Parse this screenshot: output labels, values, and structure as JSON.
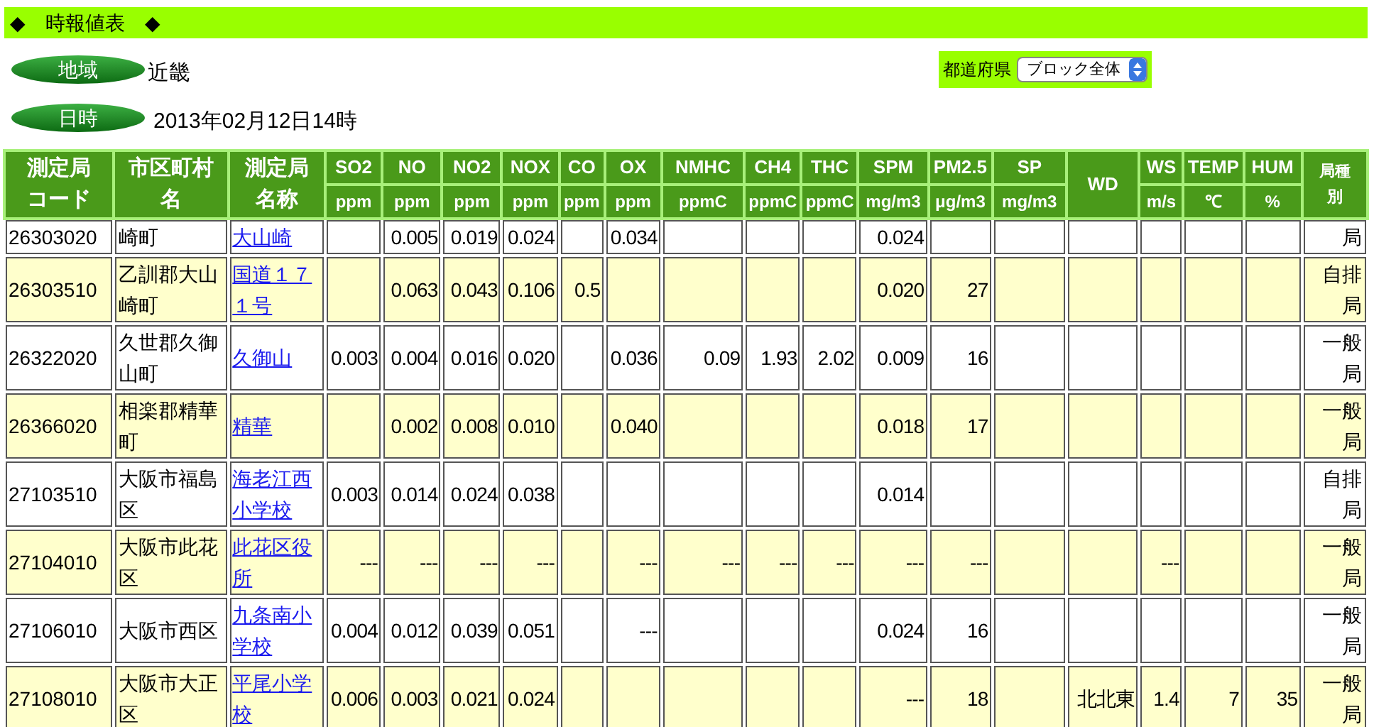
{
  "title_bar": {
    "left_mark": "◆",
    "title": "時報値表",
    "right_mark": "◆"
  },
  "region": {
    "label": "地域",
    "value": "近畿"
  },
  "prefecture": {
    "label": "都道府県",
    "value": "ブロック全体"
  },
  "datetime": {
    "label": "日時",
    "value": "2013年02月12日14時"
  },
  "table": {
    "columns": [
      {
        "label": "測定局コード"
      },
      {
        "label": "市区町村名"
      },
      {
        "label": "測定局名称"
      },
      {
        "label": "SO2",
        "unit": "ppm"
      },
      {
        "label": "NO",
        "unit": "ppm"
      },
      {
        "label": "NO2",
        "unit": "ppm"
      },
      {
        "label": "NOX",
        "unit": "ppm"
      },
      {
        "label": "CO",
        "unit": "ppm"
      },
      {
        "label": "OX",
        "unit": "ppm"
      },
      {
        "label": "NMHC",
        "unit": "ppmC"
      },
      {
        "label": "CH4",
        "unit": "ppmC"
      },
      {
        "label": "THC",
        "unit": "ppmC"
      },
      {
        "label": "SPM",
        "unit": "mg/m3"
      },
      {
        "label": "PM2.5",
        "unit": "μg/m3"
      },
      {
        "label": "SP",
        "unit": "mg/m3"
      },
      {
        "label": "WD"
      },
      {
        "label": "WS",
        "unit": "m/s"
      },
      {
        "label": "TEMP",
        "unit": "℃"
      },
      {
        "label": "HUM",
        "unit": "%"
      },
      {
        "label": "局種別"
      }
    ],
    "rows": [
      {
        "code": "26303020",
        "city": "崎町",
        "station": "大山崎",
        "values": {
          "no": "0.005",
          "no2": "0.019",
          "nox": "0.024",
          "ox": "0.034",
          "spm": "0.024"
        },
        "type": "局"
      },
      {
        "code": "26303510",
        "city": "乙訓郡大山崎町",
        "station": "国道１７１号",
        "values": {
          "no": "0.063",
          "no2": "0.043",
          "nox": "0.106",
          "co": "0.5",
          "spm": "0.020",
          "pm25": "27"
        },
        "type": "自排局"
      },
      {
        "code": "26322020",
        "city": "久世郡久御山町",
        "station": "久御山",
        "values": {
          "so2": "0.003",
          "no": "0.004",
          "no2": "0.016",
          "nox": "0.020",
          "ox": "0.036",
          "nmhc": "0.09",
          "ch4": "1.93",
          "thc": "2.02",
          "spm": "0.009",
          "pm25": "16"
        },
        "type": "一般局"
      },
      {
        "code": "26366020",
        "city": "相楽郡精華町",
        "station": "精華",
        "values": {
          "no": "0.002",
          "no2": "0.008",
          "nox": "0.010",
          "ox": "0.040",
          "spm": "0.018",
          "pm25": "17"
        },
        "type": "一般局"
      },
      {
        "code": "27103510",
        "city": "大阪市福島区",
        "station": "海老江西小学校",
        "values": {
          "so2": "0.003",
          "no": "0.014",
          "no2": "0.024",
          "nox": "0.038",
          "spm": "0.014"
        },
        "type": "自排局"
      },
      {
        "code": "27104010",
        "city": "大阪市此花区",
        "station": "此花区役所",
        "values": {
          "so2": "---",
          "no": "---",
          "no2": "---",
          "nox": "---",
          "ox": "---",
          "nmhc": "---",
          "ch4": "---",
          "thc": "---",
          "spm": "---",
          "pm25": "---",
          "ws": "---"
        },
        "type": "一般局"
      },
      {
        "code": "27106010",
        "city": "大阪市西区",
        "station": "九条南小学校",
        "values": {
          "so2": "0.004",
          "no": "0.012",
          "no2": "0.039",
          "nox": "0.051",
          "ox": "---",
          "spm": "0.024",
          "pm25": "16"
        },
        "type": "一般局"
      },
      {
        "code": "27108010",
        "city": "大阪市大正区",
        "station": "平尾小学校",
        "values": {
          "so2": "0.006",
          "no": "0.003",
          "no2": "0.021",
          "nox": "0.024",
          "spm": "---",
          "pm25": "18",
          "wd": "北北東",
          "ws": "1.4",
          "temp": "7",
          "hum": "35"
        },
        "type": "一般局"
      }
    ]
  }
}
